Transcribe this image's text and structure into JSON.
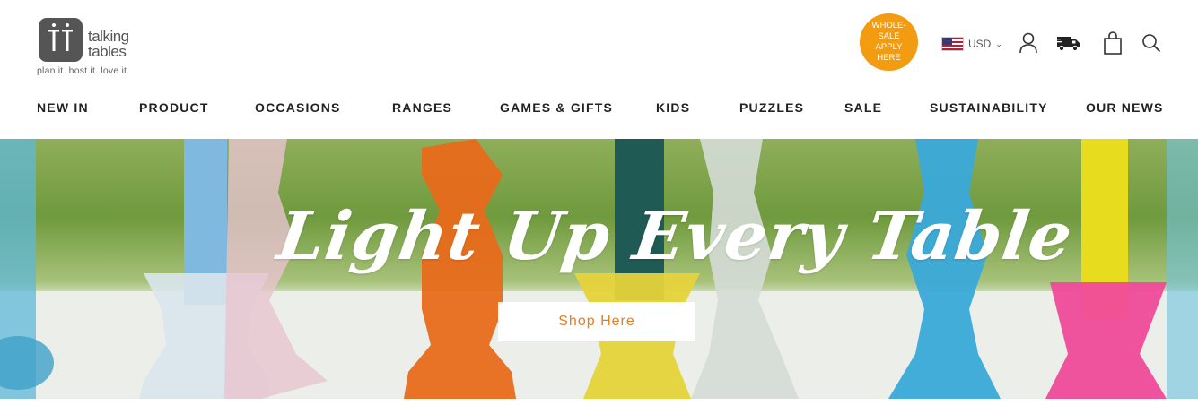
{
  "brand": {
    "name_line1": "talking",
    "name_line2": "tables",
    "tagline": "plan it. host it. love it."
  },
  "wholesale": {
    "line1": "WHOLE-",
    "line2": "SALE",
    "line3": "APPLY",
    "line4": "HERE",
    "color": "#f39c12"
  },
  "currency": {
    "selected": "USD",
    "flag_icon": "us-flag-icon"
  },
  "header_icons": [
    "account-icon",
    "delivery-truck-icon",
    "cart-bag-icon",
    "search-icon"
  ],
  "nav": {
    "items": [
      {
        "label": "NEW IN"
      },
      {
        "label": "PRODUCT"
      },
      {
        "label": "OCCASIONS"
      },
      {
        "label": "RANGES"
      },
      {
        "label": "GAMES & GIFTS"
      },
      {
        "label": "KIDS"
      },
      {
        "label": "PUZZLES"
      },
      {
        "label": "SALE"
      },
      {
        "label": "SUSTAINABILITY"
      },
      {
        "label": "OUR NEWS"
      }
    ]
  },
  "hero": {
    "title": "Light Up Every Table",
    "button_label": "Shop Here",
    "button_text_color": "#e67e22"
  }
}
